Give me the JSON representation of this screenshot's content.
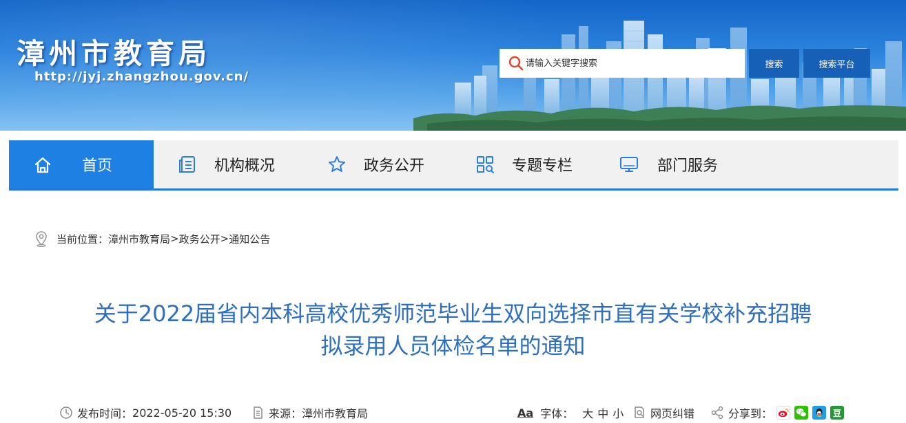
{
  "site": {
    "title": "漳州市教育局",
    "url": "http://jyj.zhangzhou.gov.cn/"
  },
  "search": {
    "placeholder": "请输入关键字搜索",
    "search_label": "搜索",
    "platform_label": "搜索平台"
  },
  "nav": {
    "items": [
      {
        "label": "首页",
        "icon": "home-icon"
      },
      {
        "label": "机构概况",
        "icon": "document-list-icon"
      },
      {
        "label": "政务公开",
        "icon": "star-icon"
      },
      {
        "label": "专题专栏",
        "icon": "grid-icon"
      },
      {
        "label": "部门服务",
        "icon": "monitor-icon"
      }
    ],
    "active_color": "#1e80e3"
  },
  "breadcrumb": {
    "prefix": "当前位置：",
    "items": [
      "漳州市教育局",
      "政务公开",
      "通知公告"
    ],
    "separator": ">"
  },
  "article": {
    "title_line1": "关于2022届省内本科高校优秀师范毕业生双向选择市直有关学校补充招聘",
    "title_line2": "拟录用人员体检名单的通知",
    "title_color": "#2e6fbe"
  },
  "meta": {
    "publish_label": "发布时间：",
    "publish_time": "2022-05-20 15:30",
    "source_label": "来源：",
    "source": "漳州市教育局",
    "font_icon_text": "Aa",
    "font_label": "字体：",
    "font_large": "大",
    "font_medium": "中",
    "font_small": "小",
    "correction_label": "网页纠错",
    "share_label": "分享到：",
    "share_icons": [
      "weibo-icon",
      "wechat-icon",
      "qq-icon",
      "douban-icon"
    ],
    "douban_text": "豆"
  }
}
